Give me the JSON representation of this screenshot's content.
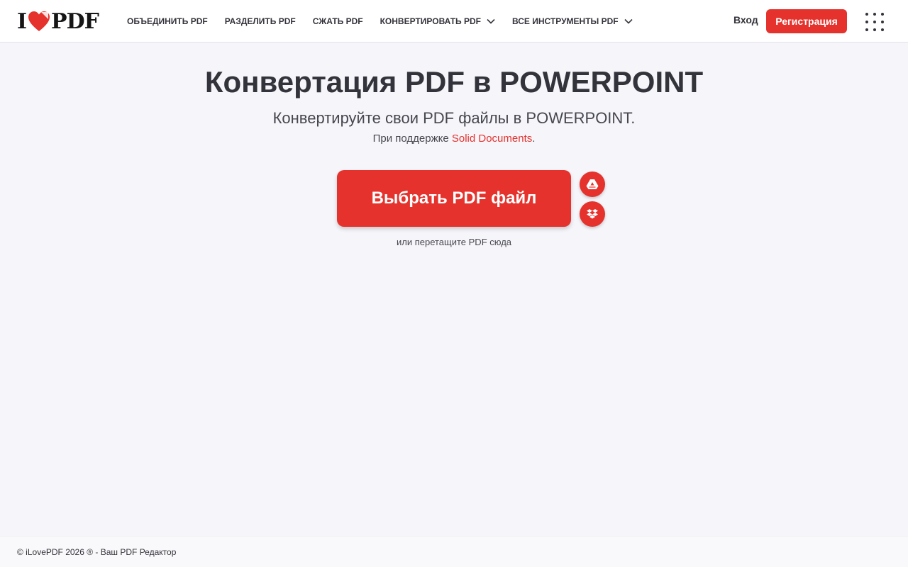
{
  "logo": {
    "text_i": "I",
    "text_pdf": "PDF"
  },
  "nav": {
    "items": [
      {
        "label": "ОБЪЕДИНИТЬ PDF",
        "dropdown": false
      },
      {
        "label": "РАЗДЕЛИТЬ PDF",
        "dropdown": false
      },
      {
        "label": "СЖАТЬ PDF",
        "dropdown": false
      },
      {
        "label": "КОНВЕРТИРОВАТЬ PDF",
        "dropdown": true
      },
      {
        "label": "ВСЕ ИНСТРУМЕНТЫ PDF",
        "dropdown": true
      }
    ]
  },
  "header": {
    "login": "Вход",
    "signup": "Регистрация"
  },
  "main": {
    "title": "Конвертация PDF в POWERPOINT",
    "subtitle": "Конвертируйте свои PDF файлы в POWERPOINT.",
    "powered_prefix": "При поддержке ",
    "powered_link": "Solid Documents",
    "powered_suffix": ".",
    "select_button": "Выбрать PDF файл",
    "drop_hint": "или перетащите PDF сюда"
  },
  "icons": {
    "logo_heart": "heart-icon",
    "gdrive": "google-drive-icon",
    "dropbox": "dropbox-icon",
    "apps": "apps-grid-icon",
    "chevron": "chevron-down-icon"
  },
  "colors": {
    "accent": "#e5322d",
    "text": "#33333b",
    "background": "#f5f5fa"
  },
  "footer": {
    "copyright": "© iLovePDF 2026 ® - Ваш PDF Редактор"
  }
}
